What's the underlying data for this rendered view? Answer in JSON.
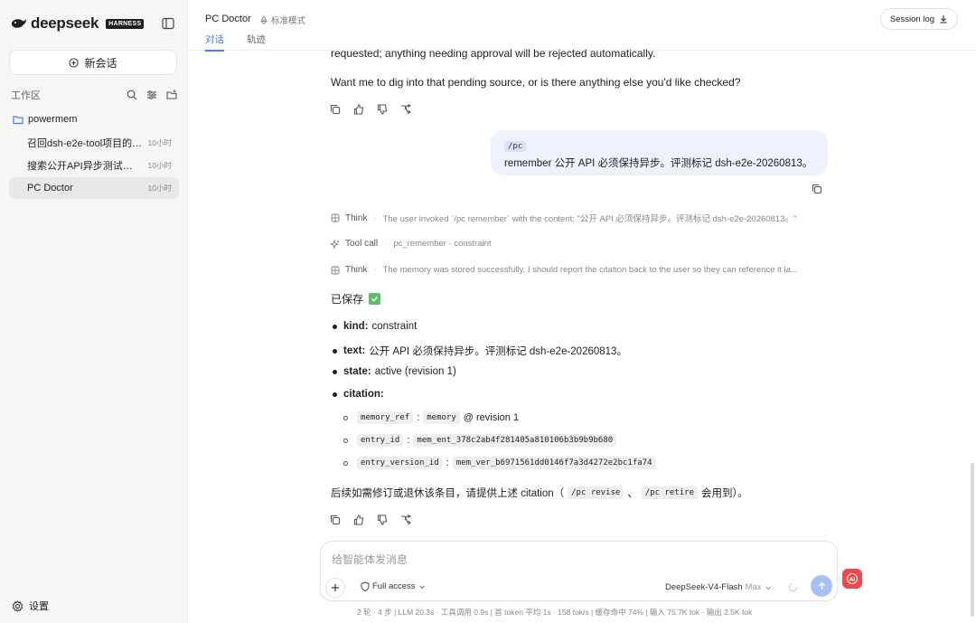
{
  "brand": {
    "name": "deepseek",
    "badge": "HARNESS"
  },
  "sidebar": {
    "new_chat_label": "新会话",
    "workspace_label": "工作区",
    "folder_name": "powermem",
    "conversations": [
      {
        "title": "召回dsh-e2e-tool项目的A...",
        "time": "10小时"
      },
      {
        "title": "搜索公开API异步测试计划",
        "time": "10小时"
      },
      {
        "title": "PC Doctor",
        "time": "10小时"
      }
    ],
    "settings_label": "设置"
  },
  "header": {
    "title": "PC Doctor",
    "mode": "标准模式",
    "tabs": [
      "对话",
      "轨迹"
    ],
    "session_log": "Session log"
  },
  "chat": {
    "partial_line": "requested; anything needing approval will be rejected automatically.",
    "question": "Want me to dig into that pending source, or is there anything else you'd like checked?",
    "user_message": {
      "command": "/pc",
      "text": "remember 公开 API 必须保持异步。评测标记 dsh-e2e-20260813。"
    },
    "trace": [
      {
        "kind": "Think",
        "text": "The user invoked `/pc remember` with the content: \"公开 API 必须保持异步。评测标记 dsh-e2e-20260813。\""
      },
      {
        "kind": "Tool call",
        "text": "pc_remember · constraint"
      },
      {
        "kind": "Think",
        "text": "The memory was stored successfully. I should report the citation back to the user so they can reference it la..."
      }
    ],
    "saved_label": "已保存",
    "fields": {
      "kind_label": "kind:",
      "kind_value": "constraint",
      "text_label": "text:",
      "text_value": "公开 API 必须保持异步。评测标记 dsh-e2e-20260813。",
      "state_label": "state:",
      "state_value": "active (revision 1)",
      "citation_label": "citation:"
    },
    "citation": {
      "memory_ref_key": "memory_ref",
      "memory_ref_value": "memory",
      "memory_ref_suffix": "@ revision 1",
      "entry_id_key": "entry_id",
      "entry_id_value": "mem_ent_378c2ab4f281405a810106b3b9b9b680",
      "entry_version_id_key": "entry_version_id",
      "entry_version_id_value": "mem_ver_b6971561dd0146f7a3d4272e2bc1fa74",
      "sep": ":"
    },
    "final": {
      "prefix": "后续如需修订或退休该条目，请提供上述 citation（",
      "cmd1": "/pc revise",
      "mid": "、",
      "cmd2": "/pc retire",
      "suffix": "会用到）。"
    }
  },
  "input": {
    "placeholder": "给智能体发消息",
    "access": "Full access",
    "model": "DeepSeek-V4-Flash",
    "model_tier": "Max"
  },
  "stats": "2 轮 · 4 步  |  LLM 20.3s · 工具调用 0.9s  |  首 token 平均 1s · 158 tok/s  |  缓存命中 74%  |  输入 75.7K tok · 输出 2.5K tok",
  "colors": {
    "accent": "#4a7cf0",
    "user_bubble": "#eef2fd",
    "send": "#a9c0f5",
    "ai_badge": "#ef4a4a",
    "check": "#5bbf66"
  }
}
